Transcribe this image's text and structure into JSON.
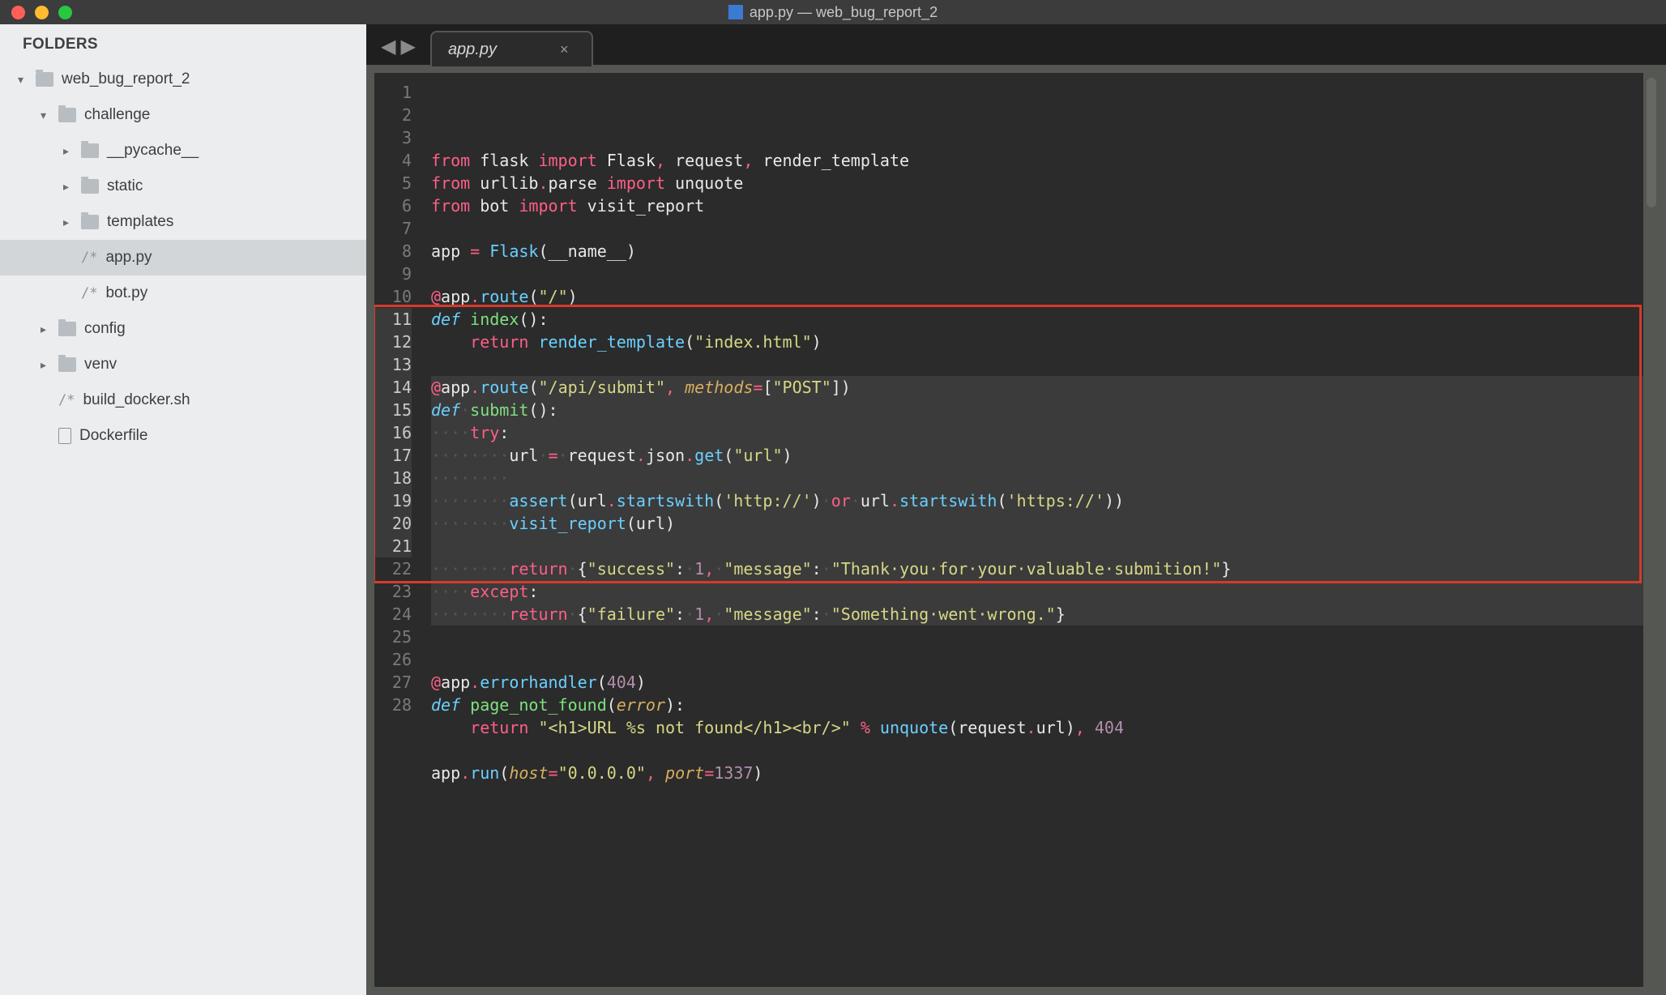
{
  "window": {
    "title": "app.py — web_bug_report_2",
    "icon": "doc-python-icon"
  },
  "sidebar": {
    "header": "FOLDERS",
    "tree": [
      {
        "depth": 0,
        "disclosure": "down",
        "icon": "folder",
        "label": "web_bug_report_2",
        "selected": false,
        "interactable": true
      },
      {
        "depth": 1,
        "disclosure": "down",
        "icon": "folder",
        "label": "challenge",
        "selected": false,
        "interactable": true
      },
      {
        "depth": 2,
        "disclosure": "right",
        "icon": "folder",
        "label": "__pycache__",
        "selected": false,
        "interactable": true
      },
      {
        "depth": 2,
        "disclosure": "right",
        "icon": "folder",
        "label": "static",
        "selected": false,
        "interactable": true
      },
      {
        "depth": 2,
        "disclosure": "right",
        "icon": "folder",
        "label": "templates",
        "selected": false,
        "interactable": true
      },
      {
        "depth": 2,
        "disclosure": "",
        "icon": "comment",
        "label": "app.py",
        "selected": true,
        "interactable": true
      },
      {
        "depth": 2,
        "disclosure": "",
        "icon": "comment",
        "label": "bot.py",
        "selected": false,
        "interactable": true
      },
      {
        "depth": 1,
        "disclosure": "right",
        "icon": "folder",
        "label": "config",
        "selected": false,
        "interactable": true
      },
      {
        "depth": 1,
        "disclosure": "right",
        "icon": "folder",
        "label": "venv",
        "selected": false,
        "interactable": true
      },
      {
        "depth": 1,
        "disclosure": "",
        "icon": "comment",
        "label": "build_docker.sh",
        "selected": false,
        "interactable": true
      },
      {
        "depth": 1,
        "disclosure": "",
        "icon": "file",
        "label": "Dockerfile",
        "selected": false,
        "interactable": true
      }
    ]
  },
  "tabs": {
    "nav_back": "◀",
    "nav_fwd": "▶",
    "active": {
      "label": "app.py",
      "close": "×"
    }
  },
  "editor": {
    "highlighted_range": [
      11,
      21
    ],
    "red_box_range": [
      11,
      22
    ],
    "lines": [
      {
        "n": 1,
        "hl": false,
        "tokens": [
          [
            "kw-import",
            "from"
          ],
          [
            "",
            " flask "
          ],
          [
            "kw-import",
            "import"
          ],
          [
            "",
            " Flask"
          ],
          [
            "op",
            ","
          ],
          [
            "",
            " request"
          ],
          [
            "op",
            ","
          ],
          [
            "",
            " render_template"
          ]
        ]
      },
      {
        "n": 2,
        "hl": false,
        "tokens": [
          [
            "kw-import",
            "from"
          ],
          [
            "",
            " urllib"
          ],
          [
            "op",
            "."
          ],
          [
            "",
            "parse "
          ],
          [
            "kw-import",
            "import"
          ],
          [
            "",
            " unquote"
          ]
        ]
      },
      {
        "n": 3,
        "hl": false,
        "tokens": [
          [
            "kw-import",
            "from"
          ],
          [
            "",
            " bot "
          ],
          [
            "kw-import",
            "import"
          ],
          [
            "",
            " visit_report"
          ]
        ]
      },
      {
        "n": 4,
        "hl": false,
        "tokens": []
      },
      {
        "n": 5,
        "hl": false,
        "tokens": [
          [
            "",
            "app "
          ],
          [
            "op",
            "="
          ],
          [
            "",
            " "
          ],
          [
            "call",
            "Flask"
          ],
          [
            "",
            "(__name__)"
          ]
        ]
      },
      {
        "n": 6,
        "hl": false,
        "tokens": []
      },
      {
        "n": 7,
        "hl": false,
        "tokens": [
          [
            "decor",
            "@"
          ],
          [
            "",
            "app"
          ],
          [
            "op",
            "."
          ],
          [
            "call",
            "route"
          ],
          [
            "",
            "("
          ],
          [
            "str",
            "\"/\""
          ],
          [
            "",
            ")"
          ]
        ]
      },
      {
        "n": 8,
        "hl": false,
        "tokens": [
          [
            "kw-def",
            "def"
          ],
          [
            "",
            " "
          ],
          [
            "fn-name",
            "index"
          ],
          [
            "",
            "():"
          ]
        ]
      },
      {
        "n": 9,
        "hl": false,
        "tokens": [
          [
            "",
            "    "
          ],
          [
            "kw-control",
            "return"
          ],
          [
            "",
            " "
          ],
          [
            "call",
            "render_template"
          ],
          [
            "",
            "("
          ],
          [
            "str",
            "\"index.html\""
          ],
          [
            "",
            ")"
          ]
        ]
      },
      {
        "n": 10,
        "hl": false,
        "tokens": []
      },
      {
        "n": 11,
        "hl": true,
        "tokens": [
          [
            "decor",
            "@"
          ],
          [
            "",
            "app"
          ],
          [
            "op",
            "."
          ],
          [
            "call",
            "route"
          ],
          [
            "",
            "("
          ],
          [
            "str",
            "\"/api/submit\""
          ],
          [
            "op",
            ","
          ],
          [
            "",
            " "
          ],
          [
            "param",
            "methods"
          ],
          [
            "op",
            "="
          ],
          [
            "",
            "["
          ],
          [
            "str",
            "\"POST\""
          ],
          [
            "",
            "])"
          ]
        ]
      },
      {
        "n": 12,
        "hl": true,
        "tokens": [
          [
            "kw-def",
            "def"
          ],
          [
            "ws-dot",
            "·"
          ],
          [
            "fn-name",
            "submit"
          ],
          [
            "",
            "():"
          ]
        ]
      },
      {
        "n": 13,
        "hl": true,
        "tokens": [
          [
            "ws-dot",
            "····"
          ],
          [
            "kw-control",
            "try"
          ],
          [
            "",
            ":"
          ]
        ]
      },
      {
        "n": 14,
        "hl": true,
        "tokens": [
          [
            "ws-dot",
            "········"
          ],
          [
            "",
            "url"
          ],
          [
            "ws-dot",
            "·"
          ],
          [
            "op",
            "="
          ],
          [
            "ws-dot",
            "·"
          ],
          [
            "",
            "request"
          ],
          [
            "op",
            "."
          ],
          [
            "",
            "json"
          ],
          [
            "op",
            "."
          ],
          [
            "call",
            "get"
          ],
          [
            "",
            "("
          ],
          [
            "str",
            "\"url\""
          ],
          [
            "",
            ")"
          ]
        ]
      },
      {
        "n": 15,
        "hl": true,
        "tokens": [
          [
            "ws-dot",
            "········"
          ]
        ]
      },
      {
        "n": 16,
        "hl": true,
        "tokens": [
          [
            "ws-dot",
            "········"
          ],
          [
            "call",
            "assert"
          ],
          [
            "",
            "(url"
          ],
          [
            "op",
            "."
          ],
          [
            "call",
            "startswith"
          ],
          [
            "",
            "("
          ],
          [
            "str",
            "'http://'"
          ],
          [
            "",
            ")"
          ],
          [
            "ws-dot",
            "·"
          ],
          [
            "op",
            "or"
          ],
          [
            "ws-dot",
            "·"
          ],
          [
            "",
            "url"
          ],
          [
            "op",
            "."
          ],
          [
            "call",
            "startswith"
          ],
          [
            "",
            "("
          ],
          [
            "str",
            "'https://'"
          ],
          [
            "",
            "))"
          ]
        ]
      },
      {
        "n": 17,
        "hl": true,
        "tokens": [
          [
            "ws-dot",
            "········"
          ],
          [
            "call",
            "visit_report"
          ],
          [
            "",
            "(url)"
          ]
        ]
      },
      {
        "n": 18,
        "hl": true,
        "tokens": []
      },
      {
        "n": 19,
        "hl": true,
        "tokens": [
          [
            "ws-dot",
            "········"
          ],
          [
            "kw-control",
            "return"
          ],
          [
            "ws-dot",
            "·"
          ],
          [
            "",
            "{"
          ],
          [
            "str",
            "\"success\""
          ],
          [
            "",
            ":"
          ],
          [
            "ws-dot",
            "·"
          ],
          [
            "num",
            "1"
          ],
          [
            "op",
            ","
          ],
          [
            "ws-dot",
            "·"
          ],
          [
            "str",
            "\"message\""
          ],
          [
            "",
            ":"
          ],
          [
            "ws-dot",
            "·"
          ],
          [
            "str",
            "\"Thank·you·for·your·valuable·submition!\""
          ],
          [
            "",
            "}"
          ]
        ]
      },
      {
        "n": 20,
        "hl": true,
        "tokens": [
          [
            "ws-dot",
            "····"
          ],
          [
            "kw-control",
            "except"
          ],
          [
            "",
            ":"
          ]
        ]
      },
      {
        "n": 21,
        "hl": true,
        "tokens": [
          [
            "ws-dot",
            "········"
          ],
          [
            "kw-control",
            "return"
          ],
          [
            "ws-dot",
            "·"
          ],
          [
            "",
            "{"
          ],
          [
            "str",
            "\"failure\""
          ],
          [
            "",
            ":"
          ],
          [
            "ws-dot",
            "·"
          ],
          [
            "num",
            "1"
          ],
          [
            "op",
            ","
          ],
          [
            "ws-dot",
            "·"
          ],
          [
            "str",
            "\"message\""
          ],
          [
            "",
            ":"
          ],
          [
            "ws-dot",
            "·"
          ],
          [
            "str",
            "\"Something·went·wrong.\""
          ],
          [
            "",
            "}"
          ]
        ]
      },
      {
        "n": 22,
        "hl": false,
        "tokens": []
      },
      {
        "n": 23,
        "hl": false,
        "tokens": []
      },
      {
        "n": 24,
        "hl": false,
        "tokens": [
          [
            "decor",
            "@"
          ],
          [
            "",
            "app"
          ],
          [
            "op",
            "."
          ],
          [
            "call",
            "errorhandler"
          ],
          [
            "",
            "("
          ],
          [
            "num",
            "404"
          ],
          [
            "",
            ")"
          ]
        ]
      },
      {
        "n": 25,
        "hl": false,
        "tokens": [
          [
            "kw-def",
            "def"
          ],
          [
            "",
            " "
          ],
          [
            "fn-name",
            "page_not_found"
          ],
          [
            "",
            "("
          ],
          [
            "param",
            "error"
          ],
          [
            "",
            "):"
          ]
        ]
      },
      {
        "n": 26,
        "hl": false,
        "tokens": [
          [
            "",
            "    "
          ],
          [
            "kw-control",
            "return"
          ],
          [
            "",
            " "
          ],
          [
            "str",
            "\"<h1>URL %s not found</h1><br/>\""
          ],
          [
            "",
            " "
          ],
          [
            "op",
            "%"
          ],
          [
            "",
            " "
          ],
          [
            "call",
            "unquote"
          ],
          [
            "",
            "(request"
          ],
          [
            "op",
            "."
          ],
          [
            "",
            "url)"
          ],
          [
            "op",
            ","
          ],
          [
            "",
            " "
          ],
          [
            "num",
            "404"
          ]
        ]
      },
      {
        "n": 27,
        "hl": false,
        "tokens": []
      },
      {
        "n": 28,
        "hl": false,
        "tokens": [
          [
            "",
            "app"
          ],
          [
            "op",
            "."
          ],
          [
            "call",
            "run"
          ],
          [
            "",
            "("
          ],
          [
            "param",
            "host"
          ],
          [
            "op",
            "="
          ],
          [
            "str",
            "\"0.0.0.0\""
          ],
          [
            "op",
            ","
          ],
          [
            "",
            " "
          ],
          [
            "param",
            "port"
          ],
          [
            "op",
            "="
          ],
          [
            "num",
            "1337"
          ],
          [
            "",
            ")"
          ]
        ]
      }
    ]
  }
}
